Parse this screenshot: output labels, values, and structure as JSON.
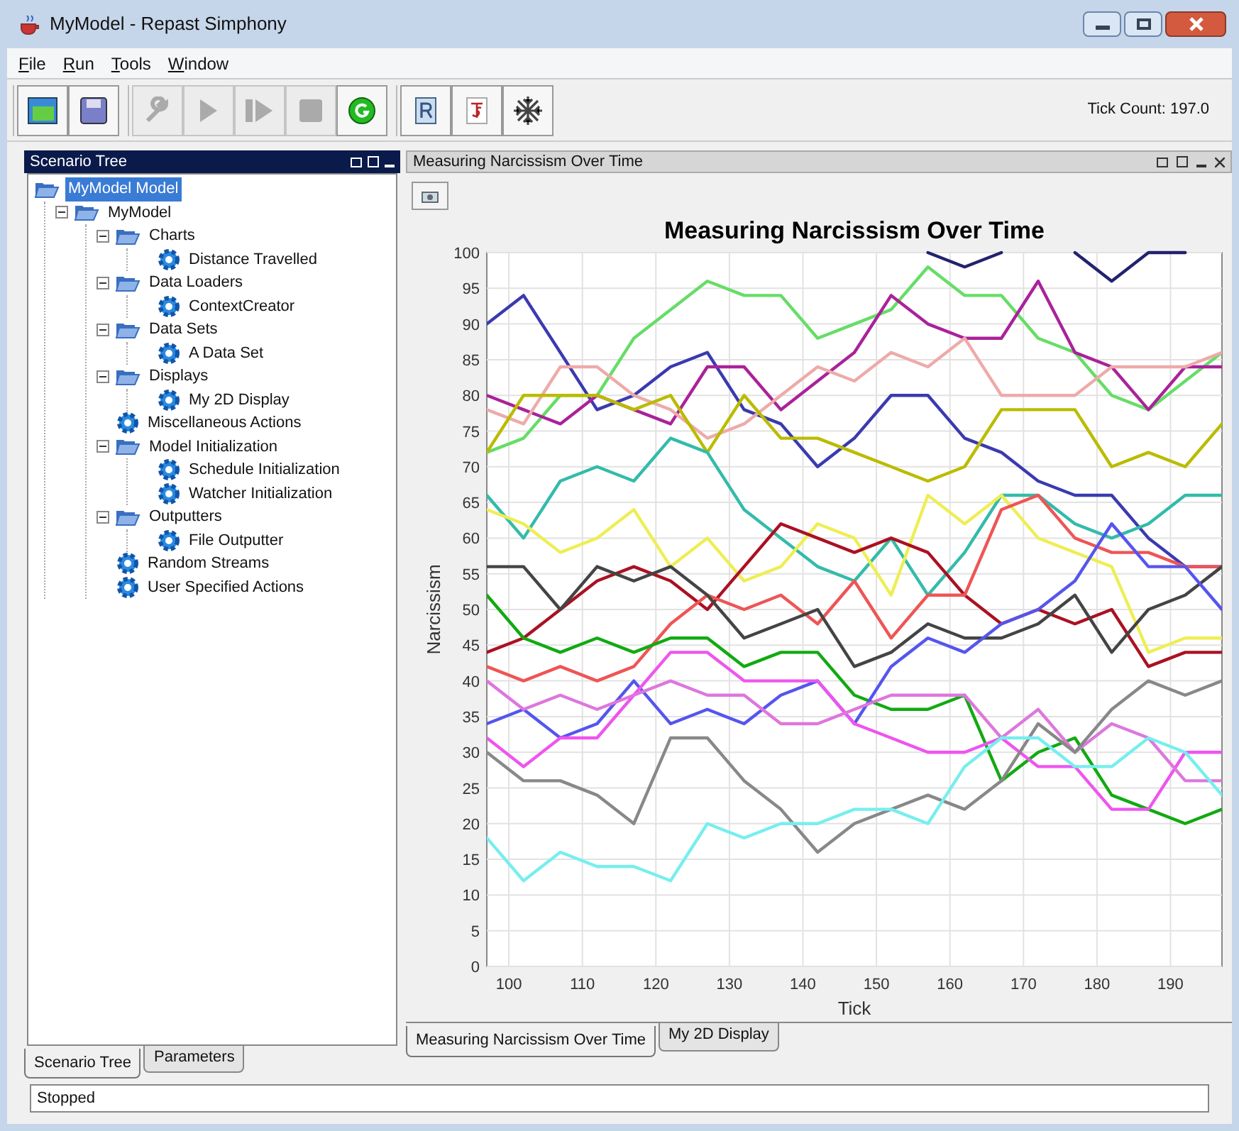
{
  "window": {
    "title": "MyModel - Repast Simphony"
  },
  "menu": [
    "File",
    "Run",
    "Tools",
    "Window"
  ],
  "toolbar": [
    [
      {
        "kind": "open",
        "disabled": false
      },
      {
        "kind": "save",
        "disabled": false
      }
    ],
    [
      {
        "kind": "wrench",
        "disabled": true
      },
      {
        "kind": "play",
        "disabled": true
      },
      {
        "kind": "step",
        "disabled": true
      },
      {
        "kind": "stop",
        "disabled": true
      },
      {
        "kind": "reset",
        "disabled": false
      }
    ],
    [
      {
        "kind": "r",
        "disabled": false
      },
      {
        "kind": "js",
        "disabled": false
      },
      {
        "kind": "freeze",
        "disabled": false
      }
    ]
  ],
  "tick_count": "Tick Count: 197.0",
  "left_panel": {
    "title": "Scenario Tree",
    "tree": [
      {
        "label": "MyModel Model",
        "kind": "folder",
        "selected": true,
        "children": [
          {
            "label": "MyModel",
            "kind": "folder",
            "expanded": true,
            "selected": false,
            "children": [
              {
                "label": "Charts",
                "kind": "folder",
                "expanded": true,
                "selected": false,
                "children": [
                  {
                    "label": "Distance Travelled",
                    "kind": "action",
                    "selected": false
                  }
                ]
              },
              {
                "label": "Data Loaders",
                "kind": "folder",
                "expanded": true,
                "selected": false,
                "children": [
                  {
                    "label": "ContextCreator",
                    "kind": "action",
                    "selected": false
                  }
                ]
              },
              {
                "label": "Data Sets",
                "kind": "folder",
                "expanded": true,
                "selected": false,
                "children": [
                  {
                    "label": "A Data Set",
                    "kind": "action",
                    "selected": false
                  }
                ]
              },
              {
                "label": "Displays",
                "kind": "folder",
                "expanded": true,
                "selected": false,
                "children": [
                  {
                    "label": "My 2D Display",
                    "kind": "action",
                    "selected": false
                  }
                ]
              },
              {
                "label": "Miscellaneous Actions",
                "kind": "action",
                "selected": false
              },
              {
                "label": "Model Initialization",
                "kind": "folder",
                "expanded": true,
                "selected": false,
                "children": [
                  {
                    "label": "Schedule Initialization",
                    "kind": "action",
                    "selected": false
                  },
                  {
                    "label": "Watcher Initialization",
                    "kind": "action",
                    "selected": false
                  }
                ]
              },
              {
                "label": "Outputters",
                "kind": "folder",
                "expanded": true,
                "selected": false,
                "children": [
                  {
                    "label": "File Outputter",
                    "kind": "action",
                    "selected": false
                  }
                ]
              },
              {
                "label": "Random Streams",
                "kind": "action",
                "selected": false
              },
              {
                "label": "User Specified Actions",
                "kind": "action",
                "selected": false
              }
            ]
          }
        ]
      }
    ],
    "tabs": [
      {
        "label": "Scenario Tree",
        "selected": true
      },
      {
        "label": "Parameters",
        "selected": false
      }
    ]
  },
  "right_panel": {
    "title": "Measuring Narcissism Over Time",
    "chart_data": {
      "type": "line",
      "title": "Measuring Narcissism Over Time",
      "xlabel": "Tick",
      "ylabel": "Narcissism",
      "x": [
        97,
        102,
        107,
        112,
        117,
        122,
        127,
        132,
        137,
        142,
        147,
        152,
        157,
        162,
        167,
        172,
        177,
        182,
        187,
        192,
        197
      ],
      "grid": true,
      "xlim": [
        97,
        197
      ],
      "ylim": [
        0,
        100
      ],
      "xticks": [
        100,
        110,
        120,
        130,
        140,
        150,
        160,
        170,
        180,
        190
      ],
      "yticks": [
        0,
        5,
        10,
        15,
        20,
        25,
        30,
        35,
        40,
        45,
        50,
        55,
        60,
        65,
        70,
        75,
        80,
        85,
        90,
        95,
        100
      ],
      "series": [
        {
          "color": "#3a3ab0",
          "values": [
            90,
            94,
            86,
            78,
            80,
            84,
            86,
            78,
            76,
            70,
            74,
            80,
            80,
            74,
            72,
            68,
            66,
            66,
            60,
            56,
            56
          ]
        },
        {
          "color": "#22226e",
          "values": [
            null,
            null,
            null,
            null,
            null,
            null,
            null,
            null,
            null,
            null,
            null,
            null,
            100,
            98,
            100,
            null,
            100,
            96,
            100,
            100,
            null
          ]
        },
        {
          "color": "#66dd66",
          "values": [
            72,
            74,
            80,
            80,
            88,
            92,
            96,
            94,
            94,
            88,
            90,
            92,
            98,
            94,
            94,
            88,
            86,
            80,
            78,
            82,
            86
          ]
        },
        {
          "color": "#aa2299",
          "values": [
            80,
            78,
            76,
            80,
            78,
            76,
            84,
            84,
            78,
            82,
            86,
            94,
            90,
            88,
            88,
            96,
            86,
            84,
            78,
            84,
            84
          ]
        },
        {
          "color": "#eeaaaa",
          "values": [
            78,
            76,
            84,
            84,
            80,
            78,
            74,
            76,
            80,
            84,
            82,
            86,
            84,
            88,
            80,
            80,
            80,
            84,
            84,
            84,
            86
          ]
        },
        {
          "color": "#bbbb00",
          "values": [
            72,
            80,
            80,
            80,
            78,
            80,
            72,
            80,
            74,
            74,
            72,
            70,
            68,
            70,
            78,
            78,
            78,
            70,
            72,
            70,
            76
          ]
        },
        {
          "color": "#33bbaa",
          "values": [
            66,
            60,
            68,
            70,
            68,
            74,
            72,
            64,
            60,
            56,
            54,
            60,
            52,
            58,
            66,
            66,
            62,
            60,
            62,
            66,
            66
          ]
        },
        {
          "color": "#eeee55",
          "values": [
            64,
            62,
            58,
            60,
            64,
            56,
            60,
            54,
            56,
            62,
            60,
            52,
            66,
            62,
            66,
            60,
            58,
            56,
            44,
            46,
            46
          ]
        },
        {
          "color": "#aa1122",
          "values": [
            44,
            46,
            50,
            54,
            56,
            54,
            50,
            56,
            62,
            60,
            58,
            60,
            58,
            52,
            48,
            50,
            48,
            50,
            42,
            44,
            44
          ]
        },
        {
          "color": "#ee5555",
          "values": [
            42,
            40,
            42,
            40,
            42,
            48,
            52,
            50,
            52,
            48,
            54,
            46,
            52,
            52,
            64,
            66,
            60,
            58,
            58,
            56,
            56
          ]
        },
        {
          "color": "#444444",
          "values": [
            56,
            56,
            50,
            56,
            54,
            56,
            52,
            46,
            48,
            50,
            42,
            44,
            48,
            46,
            46,
            48,
            52,
            44,
            50,
            52,
            56
          ]
        },
        {
          "color": "#11aa11",
          "values": [
            52,
            46,
            44,
            46,
            44,
            46,
            46,
            42,
            44,
            44,
            38,
            36,
            36,
            38,
            26,
            30,
            32,
            24,
            22,
            20,
            22
          ]
        },
        {
          "color": "#5555ee",
          "values": [
            34,
            36,
            32,
            34,
            40,
            34,
            36,
            34,
            38,
            40,
            34,
            42,
            46,
            44,
            48,
            50,
            54,
            62,
            56,
            56,
            50
          ]
        },
        {
          "color": "#ee55ee",
          "values": [
            32,
            28,
            32,
            32,
            38,
            44,
            44,
            40,
            40,
            40,
            34,
            32,
            30,
            30,
            32,
            28,
            28,
            22,
            22,
            30,
            30
          ]
        },
        {
          "color": "#dd77dd",
          "values": [
            40,
            36,
            38,
            36,
            38,
            40,
            38,
            38,
            34,
            34,
            36,
            38,
            38,
            38,
            32,
            36,
            30,
            34,
            32,
            26,
            26
          ]
        },
        {
          "color": "#888888",
          "values": [
            30,
            26,
            26,
            24,
            20,
            32,
            32,
            26,
            22,
            16,
            20,
            22,
            24,
            22,
            26,
            34,
            30,
            36,
            40,
            38,
            40
          ]
        },
        {
          "color": "#77eeee",
          "values": [
            18,
            12,
            16,
            14,
            14,
            12,
            20,
            18,
            20,
            20,
            22,
            22,
            20,
            28,
            32,
            32,
            28,
            28,
            32,
            30,
            24
          ]
        }
      ]
    },
    "tabs": [
      {
        "label": "Measuring Narcissism Over Time",
        "selected": true
      },
      {
        "label": "My 2D Display",
        "selected": false
      }
    ]
  },
  "status_bar": "Stopped"
}
